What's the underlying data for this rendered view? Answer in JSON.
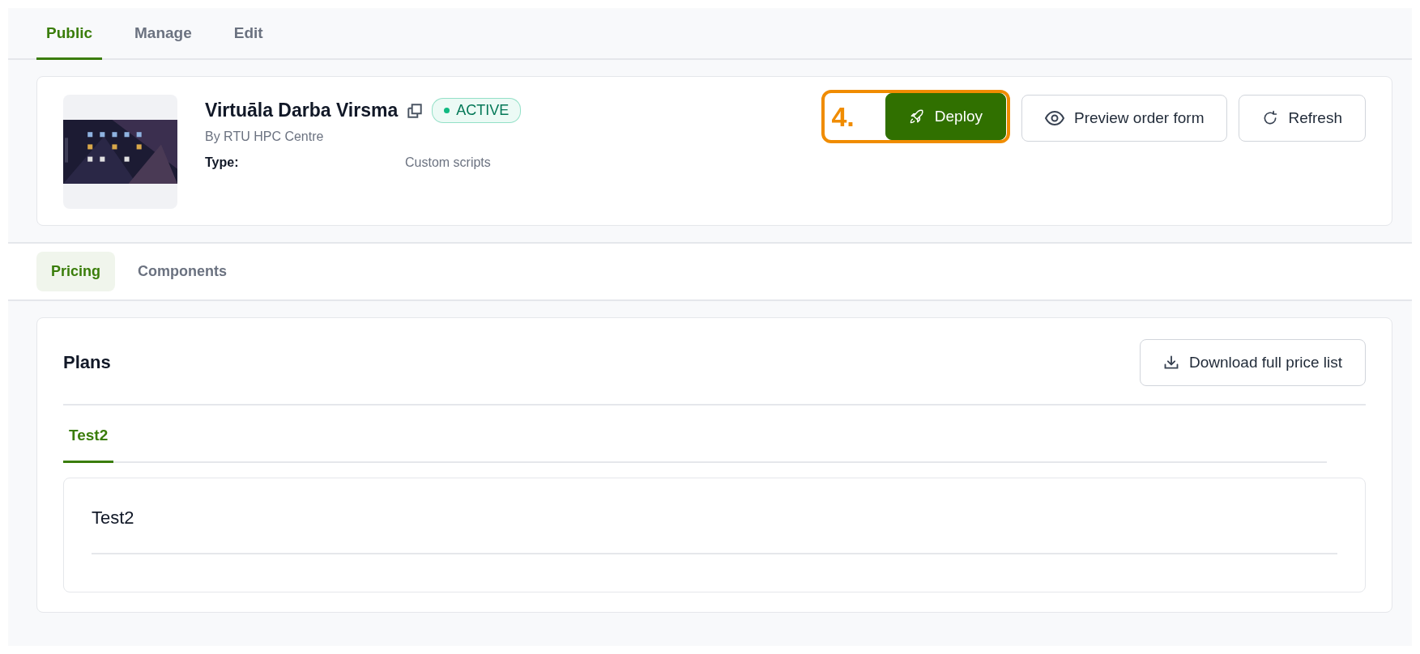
{
  "top_tabs": [
    {
      "label": "Public",
      "selected": true
    },
    {
      "label": "Manage",
      "selected": false
    },
    {
      "label": "Edit",
      "selected": false
    }
  ],
  "offering": {
    "title": "Virtuāla Darba Virsma",
    "status": {
      "label": "ACTIVE",
      "color": "#10b981"
    },
    "provider": "By RTU HPC Centre",
    "fields": [
      {
        "label": "Type:",
        "value": "Custom scripts"
      }
    ]
  },
  "annotation": {
    "label": "4."
  },
  "actions": [
    {
      "kind": "deploy",
      "label": "Deploy"
    },
    {
      "kind": "preview",
      "label": "Preview order form"
    },
    {
      "kind": "refresh",
      "label": "Refresh"
    }
  ],
  "section_tabs": [
    {
      "label": "Pricing",
      "selected": true
    },
    {
      "label": "Components",
      "selected": false
    }
  ],
  "plans": {
    "title": "Plans",
    "download_button": "Download full price list",
    "plan_tabs": [
      {
        "label": "Test2",
        "selected": true
      }
    ],
    "plan_name": "Test2"
  }
}
